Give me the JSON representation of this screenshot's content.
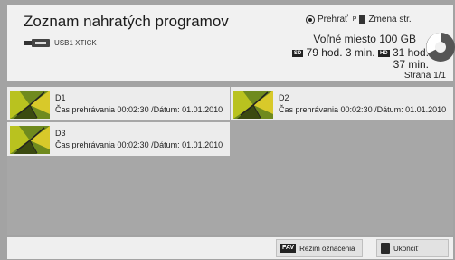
{
  "header": {
    "title": "Zoznam nahratých programov",
    "usb_label": "USB1 XTICK",
    "legend_play": "Prehrať",
    "legend_page": "Zmena str.",
    "free_space": "Voľné miesto 100 GB",
    "sd_badge": "SD",
    "sd_time": "79 hod. 3 min.",
    "hd_badge": "HD",
    "hd_time": "31 hod.",
    "hd_time_min": "37 min.",
    "page": "Strana 1/1"
  },
  "recordings": [
    {
      "name": "D1",
      "detail": "Čas prehrávania 00:02:30 /Dátum: 01.01.2010"
    },
    {
      "name": "D2",
      "detail": "Čas prehrávania 00:02:30 /Dátum: 01.01.2010"
    },
    {
      "name": "D3",
      "detail": "Čas prehrávania 00:02:30 /Dátum: 01.01.2010"
    }
  ],
  "footer": {
    "fav_badge": "FAV",
    "mark_mode": "Režim označenia",
    "exit": "Ukončiť"
  },
  "icons": [
    "usb-icon",
    "ok-icon",
    "page-icon",
    "disk-usage-icon",
    "butterfly-thumbnail-icon",
    "exit-icon"
  ]
}
